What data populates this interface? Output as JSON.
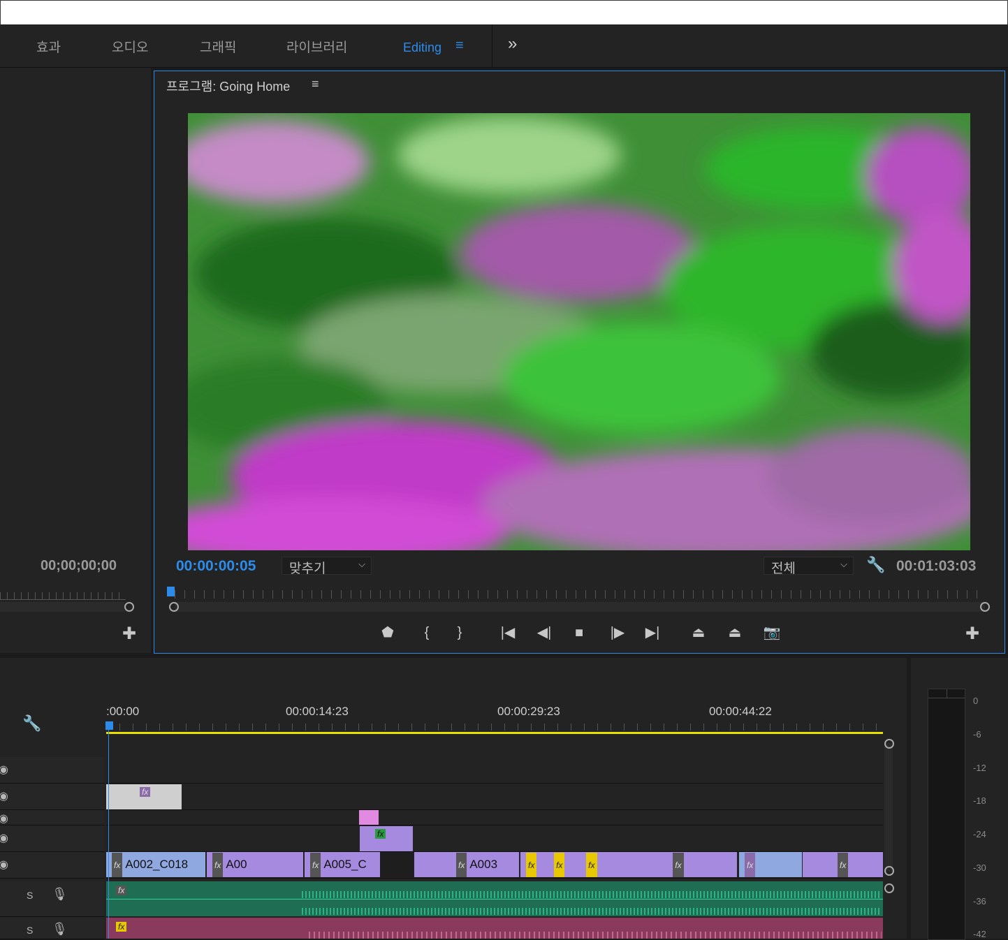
{
  "tabs": [
    {
      "label": "효과"
    },
    {
      "label": "오디오"
    },
    {
      "label": "그래픽"
    },
    {
      "label": "라이브러리"
    },
    {
      "label": "Editing"
    }
  ],
  "tab_menu_glyph": "≡",
  "overflow_glyph": "»",
  "source": {
    "timecode": "00;00;00;00"
  },
  "program": {
    "title": "프로그램: Going Home",
    "menu_glyph": "≡",
    "current_timecode": "00:00:00:05",
    "zoom_value": "맞추기",
    "resolution_value": "전체",
    "duration_timecode": "00:01:03:03"
  },
  "timeline": {
    "ruler": [
      ":00:00",
      "00:00:14:23",
      "00:00:29:23",
      "00:00:44:22"
    ],
    "clips": {
      "v1a": "A002_C018",
      "v1b": "A00",
      "v1c": "A005_C",
      "v1d": "A003"
    },
    "audio_solo": "S",
    "fx_label": "fx"
  },
  "meter": {
    "labels": [
      "0",
      "-6",
      "-12",
      "-18",
      "-24",
      "-30",
      "-36",
      "-42"
    ]
  }
}
